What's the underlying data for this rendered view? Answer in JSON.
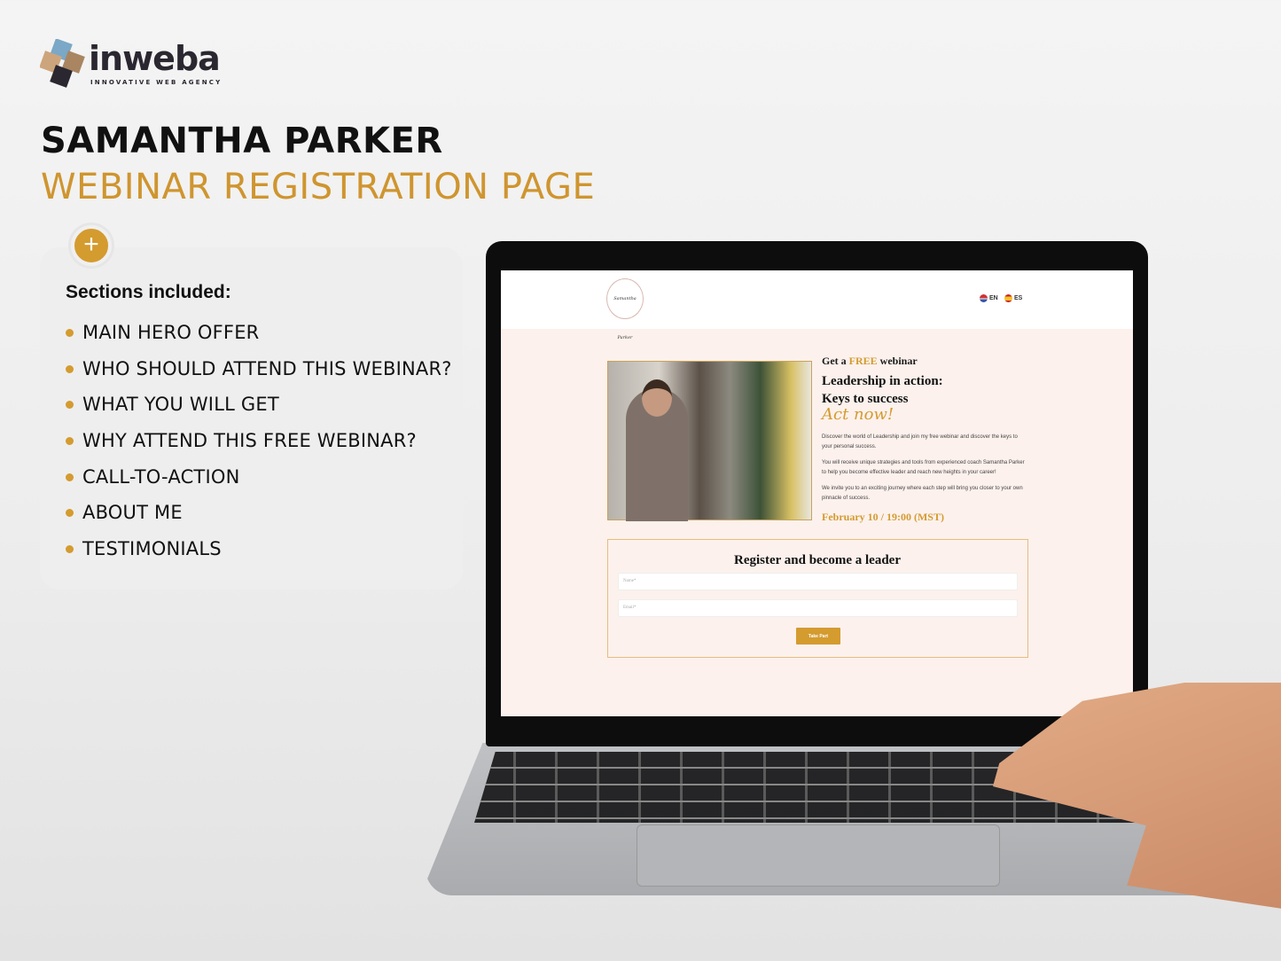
{
  "brand": {
    "name": "inweba",
    "tagline": "INNOVATIVE WEB AGENCY",
    "accent": "#d49b2f"
  },
  "title": {
    "line1": "SAMANTHA PARKER",
    "line2": "WEBINAR REGISTRATION PAGE"
  },
  "panel": {
    "icon": "plus-icon",
    "heading": "Sections included:",
    "items": [
      "MAIN HERO OFFER",
      "WHO SHOULD ATTEND THIS WEBINAR?",
      "WHAT YOU WILL GET",
      "WHY ATTEND THIS FREE WEBINAR?",
      "CALL-TO-ACTION",
      "ABOUT ME",
      "TESTIMONIALS"
    ]
  },
  "site": {
    "logo": "Samantha Parker",
    "languages": [
      {
        "code": "EN",
        "flag": "us-flag-icon"
      },
      {
        "code": "ES",
        "flag": "es-flag-icon"
      }
    ],
    "hero": {
      "pre": "Get a ",
      "free": "FREE",
      "post": " webinar",
      "headline1": "Leadership in action:",
      "headline2": "Keys to success",
      "cta_script": "Act now!",
      "paragraphs": [
        "Discover the world of Leadership and join my free webinar and discover the keys to your personal success.",
        "You will receive unique strategies and tools from experienced coach Samantha Parker to help you become effective leader and reach new heights in your career!",
        "We invite you to an exciting journey where each step will bring you closer to your own pinnacle of success."
      ],
      "date": "February 10 / 19:00 (MST)"
    },
    "form": {
      "title": "Register and become a leader",
      "name_placeholder": "Name*",
      "email_placeholder": "Email*",
      "submit": "Take Part"
    }
  }
}
